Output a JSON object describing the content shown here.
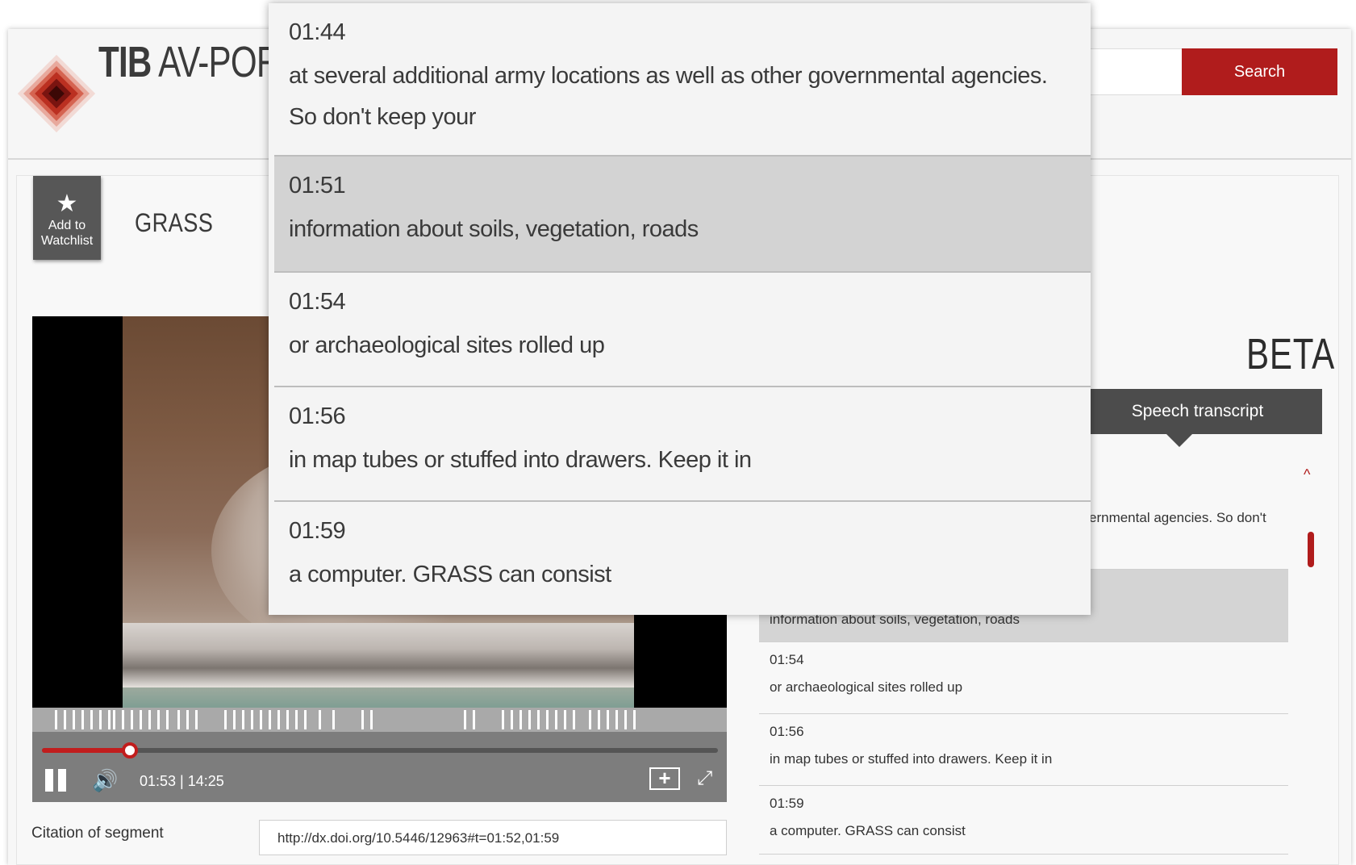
{
  "header": {
    "logo_bold": "TIB",
    "logo_rest": " AV-POR",
    "search_label": "Search"
  },
  "video": {
    "watchlist_label_line1": "Add to",
    "watchlist_label_line2": "Watchlist",
    "title": "GRASS",
    "time_display": "01:53 | 14:25",
    "progress": 0.1306
  },
  "citation": {
    "label": "Citation of segment",
    "value": "http://dx.doi.org/10.5446/12963#t=01:52,01:59"
  },
  "panel": {
    "beta": "BETA",
    "active_tab": "Speech transcript",
    "partial_text": "ernmental agencies. So don't",
    "rows": [
      {
        "time": "",
        "text": "information about soils, vegetation, roads",
        "active": true
      },
      {
        "time": "01:54",
        "text": "or archaeological sites rolled up"
      },
      {
        "time": "01:56",
        "text": "in map tubes or stuffed into drawers. Keep it in"
      },
      {
        "time": "01:59",
        "text": "a computer. GRASS can consist"
      }
    ]
  },
  "overlay": {
    "rows": [
      {
        "time": "01:44",
        "text": "at several additional army locations as well as other governmental agencies. So don't keep your"
      },
      {
        "time": "01:51",
        "text": "information about soils, vegetation, roads",
        "active": true
      },
      {
        "time": "01:54",
        "text": "or archaeological sites rolled up"
      },
      {
        "time": "01:56",
        "text": "in map tubes or stuffed into drawers. Keep it in"
      },
      {
        "time": "01:59",
        "text": "a computer. GRASS can consist"
      }
    ]
  },
  "colors": {
    "accent": "#b01c1c",
    "tab_bg": "#4c4c4c",
    "active_row": "#d3d3d3"
  },
  "icons": [
    "logo-icon",
    "star-icon",
    "pause-icon",
    "volume-icon",
    "add-segment-icon",
    "fullscreen-icon",
    "chevron-up-icon"
  ]
}
